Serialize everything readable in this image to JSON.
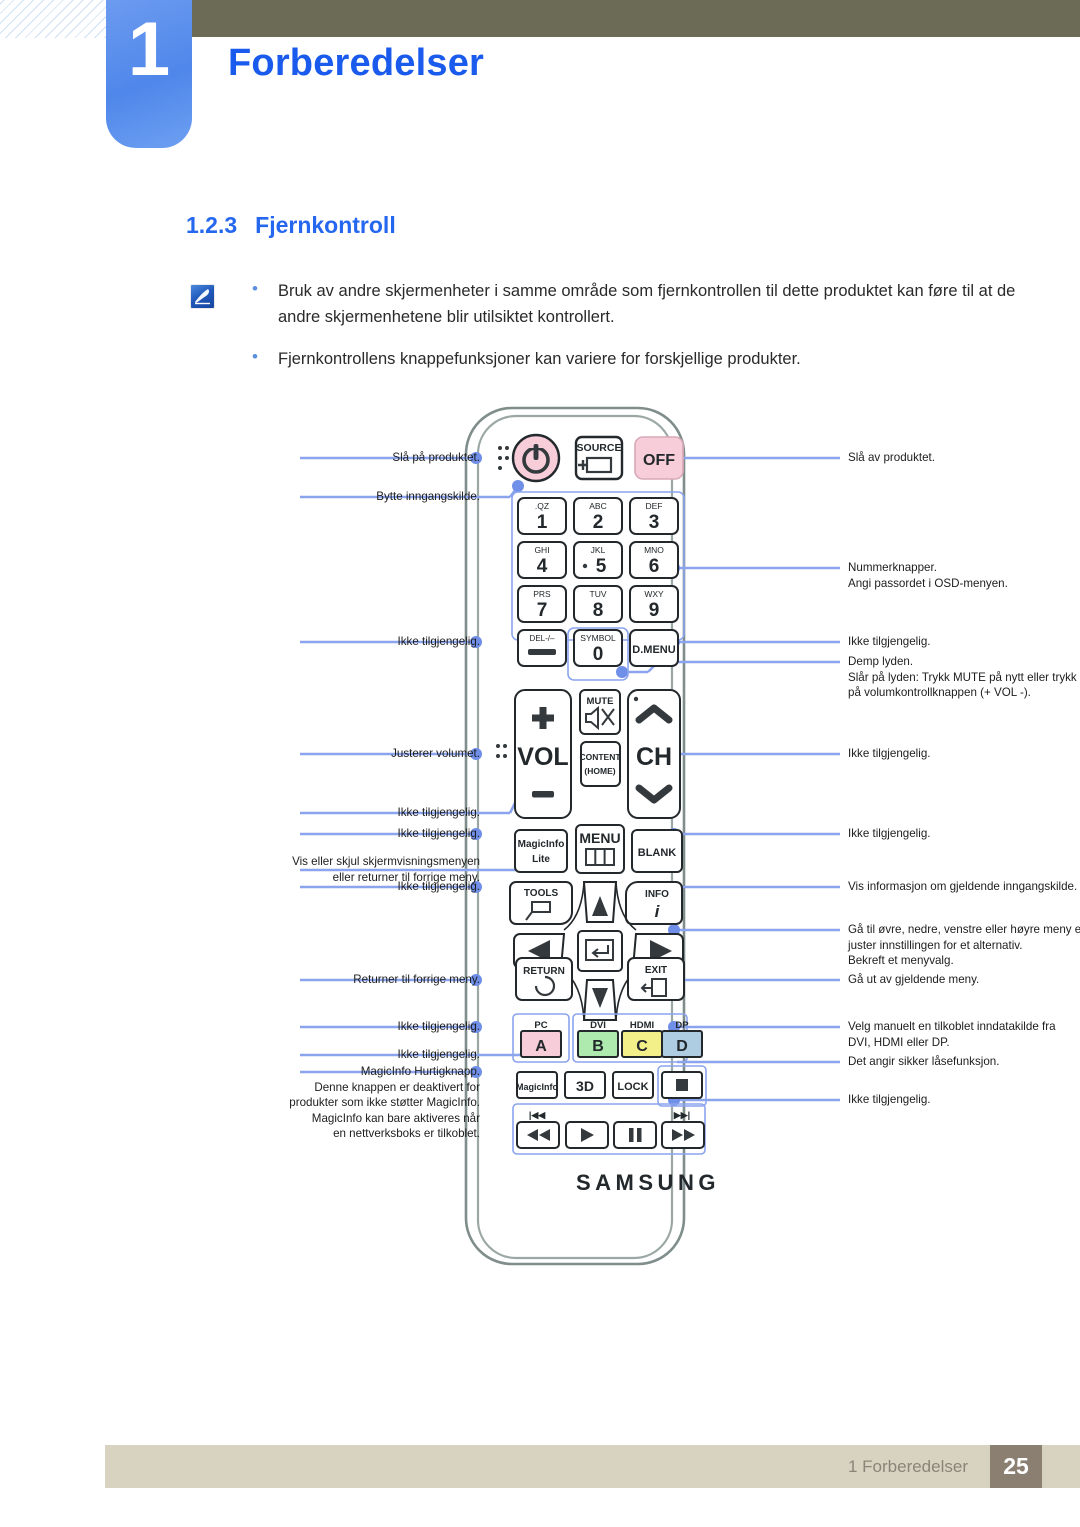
{
  "header": {
    "chapter_number": "1",
    "chapter_title": "Forberedelser"
  },
  "section": {
    "number": "1.2.3",
    "title": "Fjernkontroll"
  },
  "note": {
    "icon": "note-pen-icon",
    "bullet_glyph": "•",
    "items": [
      "Bruk av andre skjermenheter i samme område som fjernkontrollen til dette produktet kan føre til at de andre skjermenhetene blir utilsiktet kontrollert.",
      "Fjernkontrollens knappefunksjoner kan variere for forskjellige produkter."
    ]
  },
  "remote": {
    "brand": "SAMSUNG",
    "buttons": {
      "power": "power-icon",
      "source_label": "SOURCE",
      "off": "OFF",
      "keys": [
        {
          "sub": ".QZ",
          "digit": "1"
        },
        {
          "sub": "ABC",
          "digit": "2"
        },
        {
          "sub": "DEF",
          "digit": "3"
        },
        {
          "sub": "GHI",
          "digit": "4"
        },
        {
          "sub": "JKL",
          "digit": "5"
        },
        {
          "sub": "MNO",
          "digit": "6"
        },
        {
          "sub": "PRS",
          "digit": "7"
        },
        {
          "sub": "TUV",
          "digit": "8"
        },
        {
          "sub": "WXY",
          "digit": "9"
        }
      ],
      "del": "DEL-/–",
      "symbol_sub": "SYMBOL",
      "symbol_digit": "0",
      "dmenu": "D.MENU",
      "vol": "VOL",
      "mute": "MUTE",
      "content_home_line1": "CONTENT",
      "content_home_line2": "(HOME)",
      "ch": "CH",
      "magicinfo_lite_line1": "MagicInfo",
      "magicinfo_lite_line2": "Lite",
      "menu": "MENU",
      "blank": "BLANK",
      "tools": "TOOLS",
      "info": "INFO",
      "return": "RETURN",
      "exit": "EXIT",
      "color_keys": [
        {
          "top": "PC",
          "letter": "A",
          "color": "#f6cdd8"
        },
        {
          "top": "DVI",
          "letter": "B",
          "color": "#aeeaae"
        },
        {
          "top": "HDMI",
          "letter": "C",
          "color": "#f4f089"
        },
        {
          "top": "DP",
          "letter": "D",
          "color": "#aecde2"
        }
      ],
      "magicinfo": "MagicInfo",
      "three_d": "3D",
      "lock": "LOCK",
      "stop": "stop-icon",
      "prev_marker": "|◀◀",
      "next_marker": "▶▶|",
      "rewind": "rewind-icon",
      "play": "play-icon",
      "pause": "pause-icon",
      "forward": "fast-forward-icon"
    }
  },
  "callouts": {
    "left": [
      "Slå på produktet.",
      "Bytte inngangskilde.",
      "Ikke tilgjengelig.",
      "Justerer volumet.",
      "Ikke tilgjengelig.",
      "Ikke tilgjengelig.",
      "Vis eller skjul skjermvisningsmenyen\neller returner til forrige meny.",
      "Ikke tilgjengelig.",
      "Returner til forrige meny.",
      "Ikke tilgjengelig.",
      "Ikke tilgjengelig.",
      "MagicInfo Hurtigknapp.\nDenne knappen er deaktivert for\nprodukter som ikke støtter MagicInfo.\nMagicInfo kan bare aktiveres når\nen nettverksboks er tilkoblet."
    ],
    "right": [
      "Slå av produktet.",
      "Nummerknapper.\nAngi passordet i OSD-menyen.",
      "Ikke tilgjengelig.",
      "Demp lyden.\nSlår på lyden: Trykk MUTE på nytt eller trykk\npå volumkontrollknappen (+  VOL  -).",
      "Ikke tilgjengelig.",
      "Ikke tilgjengelig.",
      "Vis informasjon om gjeldende inngangskilde.",
      "Gå til øvre, nedre, venstre eller høyre meny eller\njuster innstillingen for et alternativ.\nBekreft et menyvalg.",
      "Gå ut av gjeldende meny.",
      "Velg manuelt en tilkoblet inndatakilde fra\nDVI, HDMI eller DP.",
      "Det angir sikker låsefunksjon.",
      "Ikke tilgjengelig."
    ]
  },
  "footer": {
    "text": "1 Forberedelser",
    "page": "25"
  },
  "colors": {
    "accent_blue": "#2567ee",
    "tab_blue": "#5b8ee8",
    "olive": "#6c6b55",
    "footer_bar": "#d8d3c1",
    "page_badge": "#8b7f72",
    "callout_line": "#8ba4ee",
    "remote_body": "#ffffff",
    "remote_outline": "#7b8a88"
  }
}
